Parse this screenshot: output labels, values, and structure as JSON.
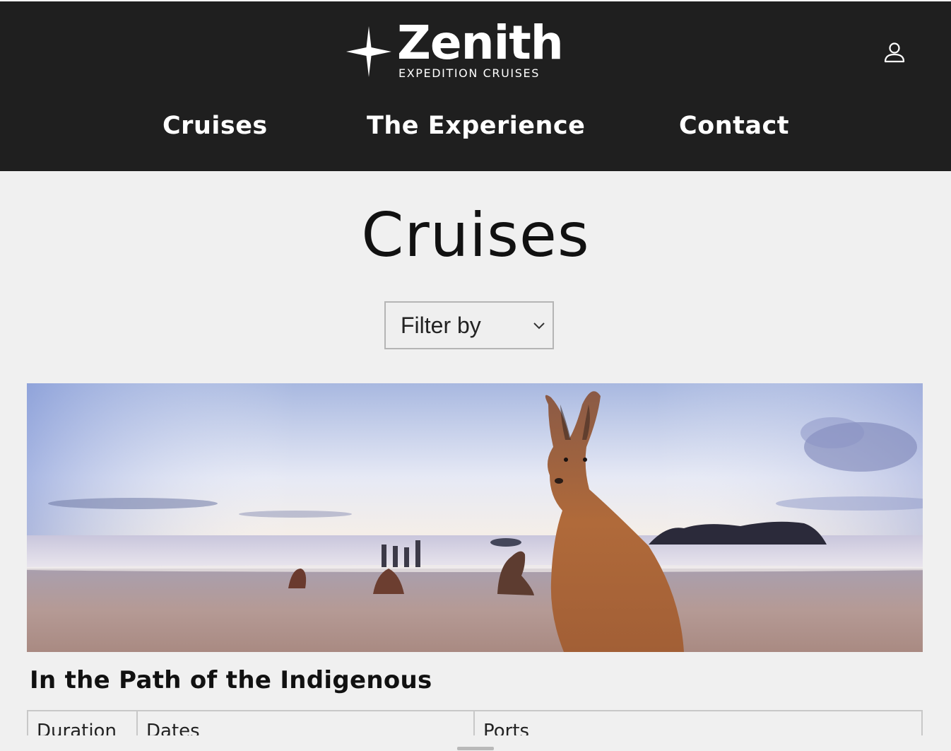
{
  "brand": {
    "name": "Zenith",
    "tagline": "EXPEDITION CRUISES"
  },
  "nav": {
    "items": [
      {
        "label": "Cruises"
      },
      {
        "label": "The Experience"
      },
      {
        "label": "Contact"
      }
    ]
  },
  "page": {
    "title": "Cruises"
  },
  "filter": {
    "selected": "Filter by"
  },
  "cruise": {
    "title": "In the Path of the Indigenous",
    "image": "kangaroos-on-beach-at-sunrise",
    "columns": [
      "Duration",
      "Dates",
      "Ports"
    ]
  },
  "icons": {
    "logo": "four-point-star-icon",
    "account": "user-icon",
    "filter": "chevron-down-icon"
  },
  "colors": {
    "header_bg": "#1f1f1f",
    "page_bg": "#f0f0f0",
    "text": "#111111",
    "border": "#c8c8c8"
  }
}
